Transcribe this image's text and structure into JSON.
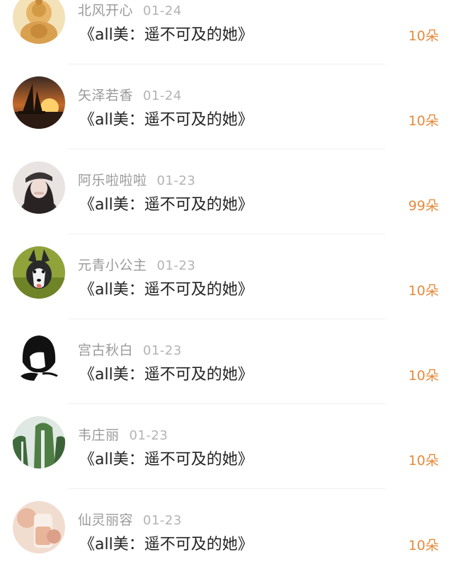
{
  "rows": [
    {
      "name": "北风开心",
      "date": "01-24",
      "title": "《all美：遥不可及的她》",
      "gift": "10朵",
      "avatar": "buddha-statue"
    },
    {
      "name": "矢泽若香",
      "date": "01-24",
      "title": "《all美：遥不可及的她》",
      "gift": "10朵",
      "avatar": "sunset-sailboat"
    },
    {
      "name": "阿乐啦啦啦",
      "date": "01-23",
      "title": "《all美：遥不可及的她》",
      "gift": "99朵",
      "avatar": "girl-with-cap"
    },
    {
      "name": "元青小公主",
      "date": "01-23",
      "title": "《all美：遥不可及的她》",
      "gift": "10朵",
      "avatar": "husky-dog"
    },
    {
      "name": "宫古秋白",
      "date": "01-23",
      "title": "《all美：遥不可及的她》",
      "gift": "10朵",
      "avatar": "black-hair-sketch"
    },
    {
      "name": "韦庄丽",
      "date": "01-23",
      "title": "《all美：遥不可及的她》",
      "gift": "10朵",
      "avatar": "green-waterfall"
    },
    {
      "name": "仙灵丽容",
      "date": "01-23",
      "title": "《all美：遥不可及的她》",
      "gift": "10朵",
      "avatar": "peach-drink"
    }
  ],
  "colors": {
    "gift": "#e58a3c",
    "name": "#9a9a9a",
    "title": "#222222"
  }
}
